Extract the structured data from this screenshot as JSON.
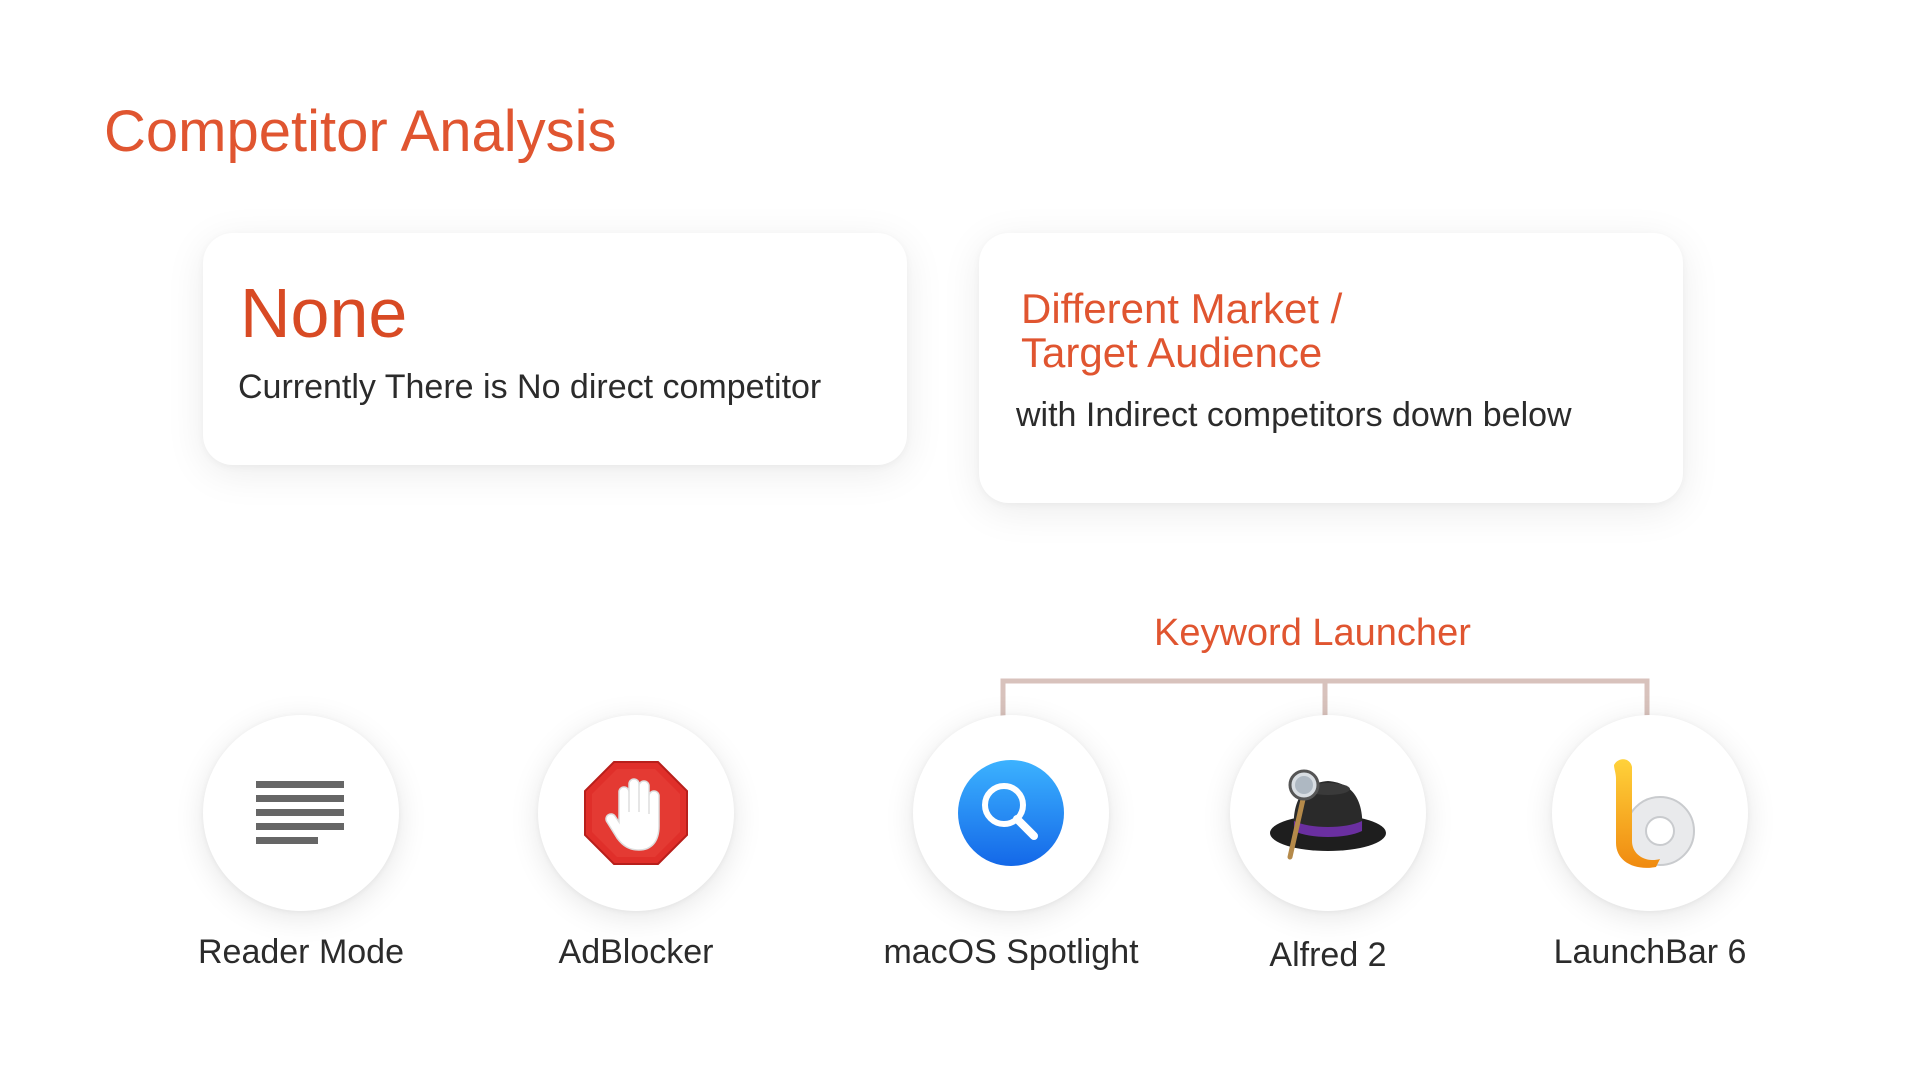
{
  "slide": {
    "title": "Competitor Analysis"
  },
  "cards": {
    "left": {
      "heading": "None",
      "text": "Currently There is No direct competitor"
    },
    "right": {
      "heading_line1": "Different Market /",
      "heading_line2": "Target Audience",
      "text": "with Indirect competitors down below"
    }
  },
  "group": {
    "label": "Keyword Launcher"
  },
  "tools": [
    {
      "label": "Reader Mode",
      "icon": "reader-mode-icon"
    },
    {
      "label": "AdBlocker",
      "icon": "adblock-hand-icon"
    },
    {
      "label": "macOS Spotlight",
      "icon": "spotlight-magnifier-icon"
    },
    {
      "label": "Alfred 2",
      "icon": "alfred-hat-icon"
    },
    {
      "label": "LaunchBar 6",
      "icon": "launchbar-icon"
    }
  ],
  "colors": {
    "accent": "#e05530",
    "bracket": "#d8c2bc",
    "text": "#2b2b2b"
  }
}
